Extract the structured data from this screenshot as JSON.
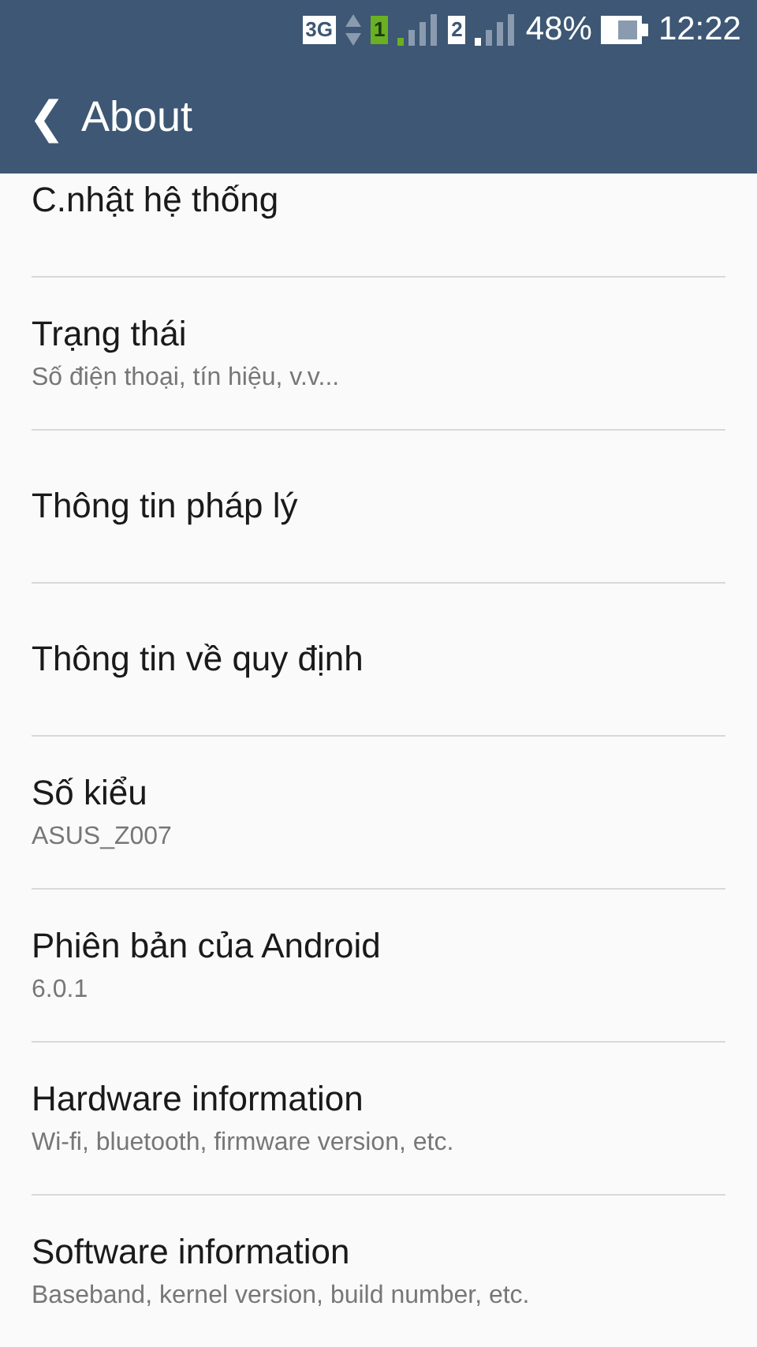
{
  "status_bar": {
    "network": "3G",
    "sim_1": "1",
    "sim_2": "2",
    "battery": "48%",
    "time": "12:22"
  },
  "app_bar": {
    "back": "❮",
    "title": "About"
  },
  "items": [
    {
      "title": "C.nhật hệ thống"
    },
    {
      "title": "Trạng thái",
      "subtitle": "Số điện thoại, tín hiệu, v.v..."
    },
    {
      "title": "Thông tin pháp lý"
    },
    {
      "title": "Thông tin về quy định"
    },
    {
      "title": "Số kiểu",
      "subtitle": "ASUS_Z007"
    },
    {
      "title": "Phiên bản của Android",
      "subtitle": "6.0.1"
    },
    {
      "title": "Hardware information",
      "subtitle": "Wi-fi, bluetooth, firmware version, etc."
    },
    {
      "title": "Software information",
      "subtitle": "Baseband, kernel version, build number, etc."
    }
  ]
}
